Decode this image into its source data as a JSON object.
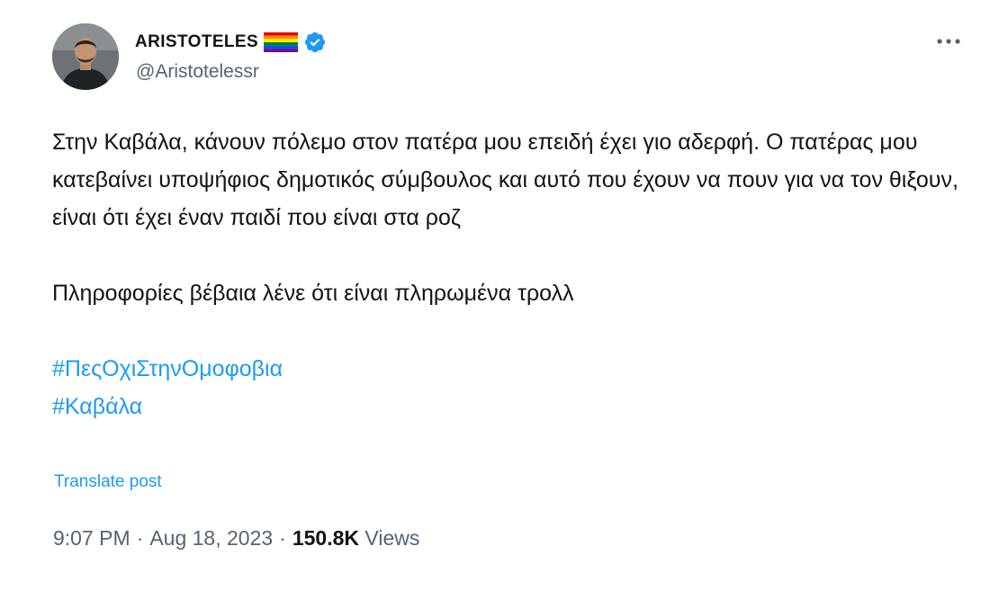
{
  "author": {
    "display_name": "ARISTOTELES",
    "handle": "@Aristotelessr",
    "flag_icon": "rainbow-flag-icon",
    "verified_icon": "verified-badge-icon",
    "verified_color": "#1d9bf0"
  },
  "menu": {
    "icon": "more-options-icon",
    "label": "···"
  },
  "tweet": {
    "paragraph_1": "Στην Καβάλα, κάνουν πόλεμο στον πατέρα μου επειδή έχει γιο αδερφή. Ο πατέρας μου κατεβαίνει υποψήφιος δημοτικός σύμβουλος και αυτό που έχουν να πουν για να τον θιξουν, είναι ότι έχει έναν παιδί που είναι στα ροζ",
    "paragraph_2": "Πληροφορίες βέβαια λένε ότι είναι πληρωμένα τρολλ",
    "hashtags": [
      "#ΠεςΟχιΣτηνΟμοφοβια",
      "#Καβάλα"
    ],
    "translate_label": "Translate post"
  },
  "meta": {
    "time": "9:07 PM",
    "separator": "·",
    "date": "Aug 18, 2023",
    "views_count": "150.8K",
    "views_label": "Views"
  },
  "colors": {
    "link": "#1d9bf0",
    "text": "#0f1419",
    "secondary": "#536471"
  }
}
